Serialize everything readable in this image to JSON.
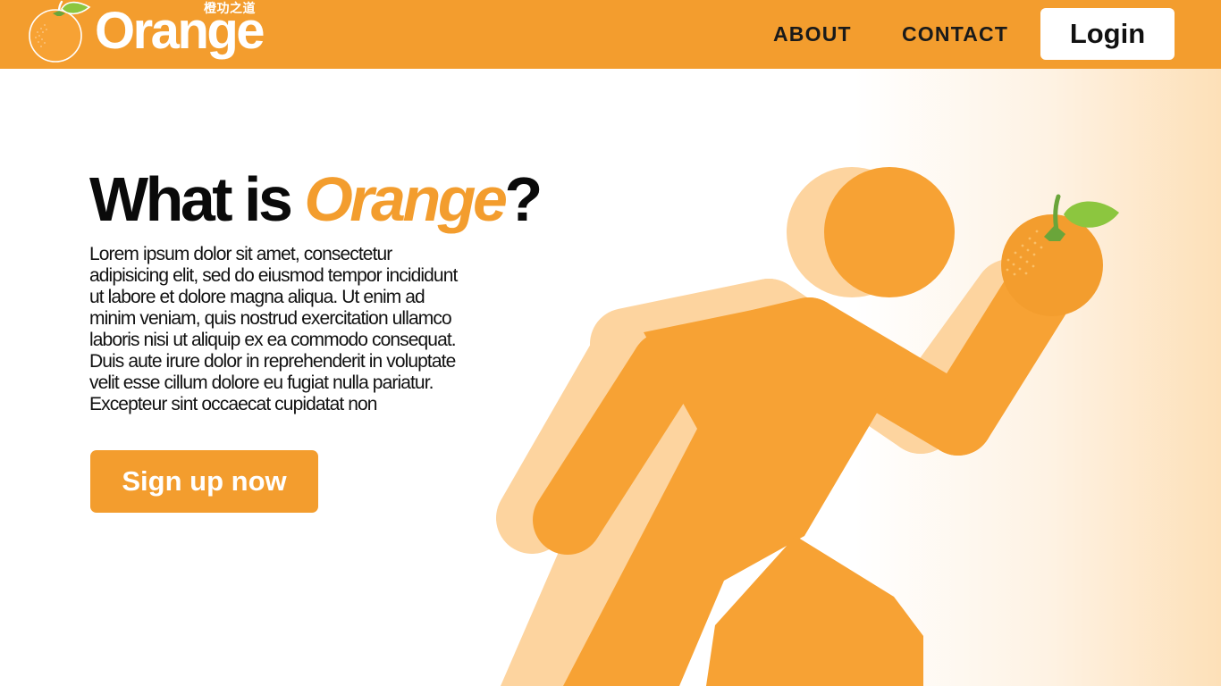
{
  "header": {
    "logo_text": "Orange",
    "logo_subtitle": "橙功之道",
    "nav": {
      "about": "ABOUT",
      "contact": "CONTACT"
    },
    "login_label": "Login"
  },
  "hero": {
    "title_prefix": "What is ",
    "title_brand": "Orange",
    "title_suffix": "?",
    "body": "Lorem ipsum dolor sit amet, consectetur adipisicing elit, sed do eiusmod tempor incididunt ut labore et dolore magna aliqua. Ut enim ad minim veniam, quis nostrud exercitation ullamco laboris nisi ut aliquip ex ea commodo consequat. Duis aute irure dolor in reprehenderit in voluptate velit esse cillum dolore eu fugiat nulla pariatur. Excepteur sint occaecat cupidatat non",
    "cta_label": "Sign up now"
  },
  "colors": {
    "brand_orange": "#f39d2e",
    "runner_orange": "#f7a234",
    "runner_shadow": "#fdd49f",
    "leaf_green": "#8cc63f",
    "text_dark": "#0a0a0a"
  },
  "icons": {
    "logo": "orange-fruit-icon",
    "illustration": "running-person-holding-orange"
  }
}
